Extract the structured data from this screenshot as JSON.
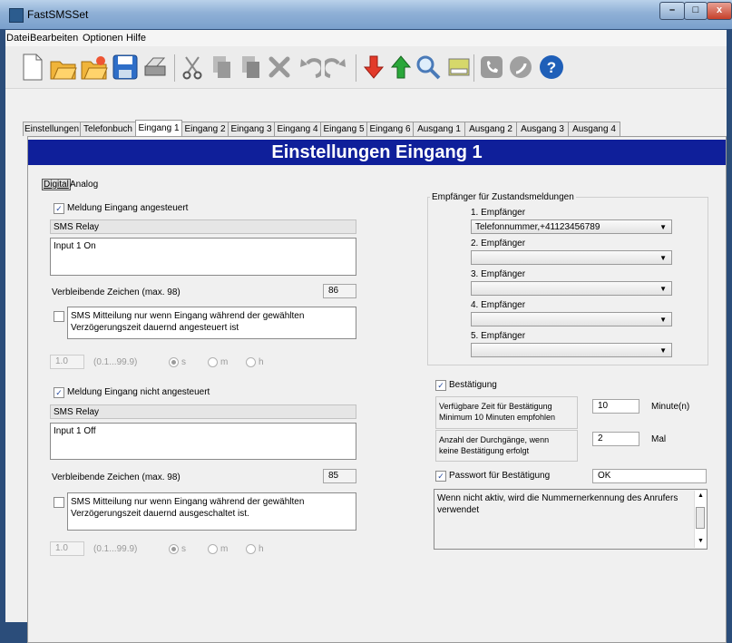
{
  "window": {
    "title": "FastSMSSet",
    "min": "–",
    "max": "□",
    "close": "x"
  },
  "menu": [
    "Datei",
    "Bearbeiten",
    "Optionen",
    "Hilfe"
  ],
  "toolbar_icons": [
    "new-file-icon",
    "open-folder-icon",
    "open-recent-icon",
    "save-icon",
    "print-icon",
    "cut-icon",
    "copy-icon",
    "paste-icon",
    "delete-icon",
    "undo-icon",
    "redo-icon",
    "download-icon",
    "upload-icon",
    "search-icon",
    "sim-card-icon",
    "phone-icon",
    "call-icon",
    "help-icon"
  ],
  "tabs": [
    "Einstellungen",
    "Telefonbuch",
    "Eingang 1",
    "Eingang 2",
    "Eingang 3",
    "Eingang 4",
    "Eingang 5",
    "Eingang 6",
    "Ausgang 1",
    "Ausgang 2",
    "Ausgang 3",
    "Ausgang 4"
  ],
  "active_tab": "Eingang 1",
  "header": "Einstellungen Eingang 1",
  "mode": {
    "digital": "Digital",
    "analog": "Analog"
  },
  "on_section": {
    "checkbox_label": "Meldung Eingang angesteuert",
    "checked": true,
    "relay": "SMS Relay",
    "message": "Input 1 On",
    "remaining_label": "Verbleibende Zeichen (max. 98)",
    "remaining": "86",
    "delay_checkbox_label_1": "SMS Mitteilung nur wenn Eingang während der gewählten",
    "delay_checkbox_label_2": "Verzögerungszeit dauernd angesteuert ist",
    "delay_value": "1.0",
    "delay_range": "(0.1...99.9)",
    "unit_s": "s",
    "unit_m": "m",
    "unit_h": "h"
  },
  "off_section": {
    "checkbox_label": "Meldung Eingang nicht angesteuert",
    "checked": true,
    "relay": "SMS Relay",
    "message": "Input 1 Off",
    "remaining_label": "Verbleibende Zeichen (max. 98)",
    "remaining": "85",
    "delay_checkbox_label_1": "SMS Mitteilung nur wenn Eingang während der gewählten",
    "delay_checkbox_label_2": "Verzögerungszeit dauernd ausgeschaltet ist.",
    "delay_value": "1.0",
    "delay_range": "(0.1...99.9)",
    "unit_s": "s",
    "unit_m": "m",
    "unit_h": "h"
  },
  "recipients": {
    "group_label": "Empfänger für Zustandsmeldungen",
    "items": [
      {
        "label": "1. Empfänger",
        "value": "Telefonnummer,+41123456789"
      },
      {
        "label": "2. Empfänger",
        "value": ""
      },
      {
        "label": "3. Empfänger",
        "value": ""
      },
      {
        "label": "4. Empfänger",
        "value": ""
      },
      {
        "label": "5. Empfänger",
        "value": ""
      }
    ]
  },
  "confirmation": {
    "checkbox_label": "Bestätigung",
    "checked": true,
    "time_label_1": "Verfügbare Zeit für Bestätigung",
    "time_label_2": "Minimum 10 Minuten empfohlen",
    "time_value": "10",
    "time_unit": "Minute(n)",
    "passes_label_1": "Anzahl der Durchgänge, wenn",
    "passes_label_2": "keine Bestätigung erfolgt",
    "passes_value": "2",
    "passes_unit": "Mal",
    "password_label": "Passwort für Bestätigung",
    "password_checked": true,
    "password_value": "OK",
    "info_text": "Wenn nicht aktiv, wird die Nummernerkennung des Anrufers verwendet"
  }
}
